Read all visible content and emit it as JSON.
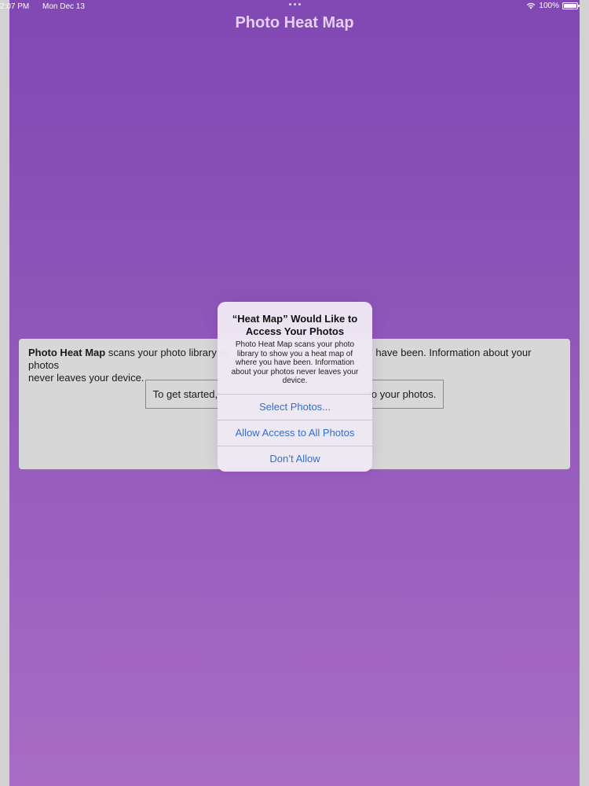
{
  "status_bar": {
    "time": "2:07 PM",
    "date": "Mon Dec 13",
    "battery": "100%",
    "wifi_icon": "wifi-icon",
    "battery_icon": "battery-icon"
  },
  "nav": {
    "title": "Photo Heat Map"
  },
  "intro": {
    "app_name": "Photo Heat Map",
    "text_visible_left": "scans your photo library to",
    "text_visible_right": "u have been. Information about your photos",
    "text_line2": "never leaves your device.",
    "get_started_left": "To get started,",
    "get_started_right": "to your photos."
  },
  "alert": {
    "title": "“Heat Map” Would Like to Access Your Photos",
    "message": "Photo Heat Map scans your photo library to show you a heat map of where you have been. Information about your photos never leaves your device.",
    "buttons": [
      {
        "label": "Select Photos..."
      },
      {
        "label": "Allow Access to All Photos"
      },
      {
        "label": "Don’t Allow"
      }
    ],
    "button_color": "#2f6fd0"
  },
  "colors": {
    "background_top": "#8147b4",
    "background_bottom": "#a86cc3"
  }
}
